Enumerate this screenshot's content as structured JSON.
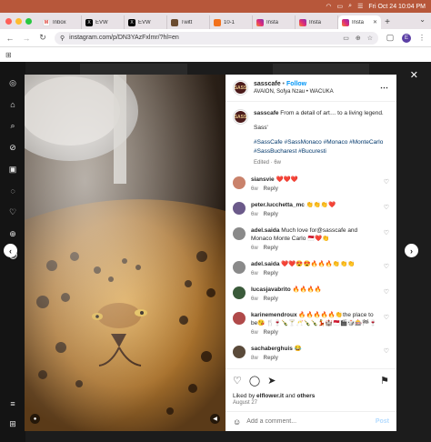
{
  "menubar": {
    "datetime": "Fri Oct 24  10:04 PM"
  },
  "tabs": [
    {
      "label": "Inbox",
      "favicon": "gmail"
    },
    {
      "label": "EVW",
      "favicon": "x"
    },
    {
      "label": "EVW",
      "favicon": "x"
    },
    {
      "label": "Twitt",
      "favicon": "tw"
    },
    {
      "label": "10-1",
      "favicon": "tp"
    },
    {
      "label": "Insta",
      "favicon": "ig"
    },
    {
      "label": "Insta",
      "favicon": "ig"
    },
    {
      "label": "Insta",
      "favicon": "ig",
      "active": true
    }
  ],
  "address": {
    "url": "instagram.com/p/DN3YAzFxlmr/?hl=en",
    "profile_initial": "E"
  },
  "post": {
    "username": "sasscafe",
    "separator": "•",
    "follow_label": "Follow",
    "subtitle": "AVAION, Sofya Nzau • WACUKA",
    "avatar_text": "SASS",
    "caption": {
      "username": "sasscafe",
      "text": "From a detail of art… to a living legend.",
      "line2": "Sass'",
      "tags": "#SassCafe #SassMonaco #Monaco #MonteCarlo #SassBucharest #Bucuresti",
      "edited": "Edited · 6w"
    },
    "comments": [
      {
        "user": "siansvie",
        "text": "❤️❤️❤️",
        "time": "6w",
        "reply": "Reply",
        "avatar_color": "#c9826b"
      },
      {
        "user": "peter.lucchetta_mc",
        "text": "👏👏👏❤️",
        "time": "6w",
        "reply": "Reply",
        "avatar_color": "#6b5a8a"
      },
      {
        "user": "adel.saida",
        "text": "Much love for@sasscafe and Monaco Monte Carlo 🇲🇨❤️👏",
        "time": "6w",
        "reply": "Reply",
        "avatar_color": "#8a8a8a"
      },
      {
        "user": "adel.saida",
        "text": "❤️❤️😍😍🔥🔥🔥👏👏👏",
        "time": "6w",
        "reply": "Reply",
        "avatar_color": "#8a8a8a"
      },
      {
        "user": "lucasjavabrito",
        "text": "🔥🔥🔥🔥",
        "time": "6w",
        "reply": "Reply",
        "avatar_color": "#3a5a3a"
      },
      {
        "user": "karinemendroux",
        "text": "🔥🔥🔥🔥🔥👏the place to be😘 🍴🍷🍾🍸🥂🍾🍾💃🏰🇲🇨🎬🎲🎰🏁🍷",
        "time": "6w",
        "reply": "Reply",
        "avatar_color": "#b04a4a"
      },
      {
        "user": "sachaberghuis",
        "text": "😂",
        "time": "8w",
        "reply": "Reply",
        "avatar_color": "#5a4a3a"
      }
    ],
    "likes_prefix": "Liked by",
    "likes_user": "elflower.it",
    "likes_and": "and",
    "likes_others": "others",
    "date": "August 27",
    "add_comment_placeholder": "Add a comment...",
    "post_label": "Post"
  },
  "icons": {
    "close": "✕",
    "prev": "‹",
    "next": "›"
  }
}
